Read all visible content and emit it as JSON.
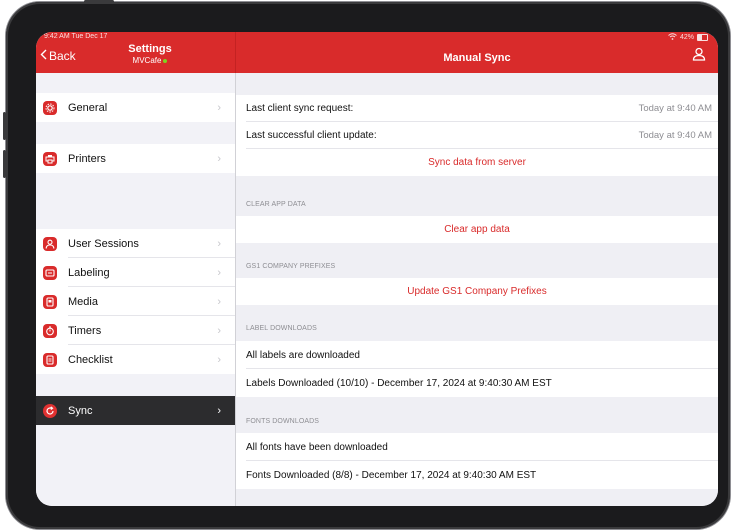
{
  "status": {
    "time": "9:42 AM  Tue Dec 17",
    "battery": "42%"
  },
  "nav": {
    "back_label": "Back",
    "settings_title": "Settings",
    "venue": "MVCafe",
    "page_title": "Manual Sync"
  },
  "sidebar": {
    "general": "General",
    "printers": "Printers",
    "user_sessions": "User Sessions",
    "labeling": "Labeling",
    "media": "Media",
    "timers": "Timers",
    "checklist": "Checklist",
    "sync": "Sync"
  },
  "sync": {
    "last_request_label": "Last client sync request:",
    "last_request_value": "Today at 9:40 AM",
    "last_update_label": "Last successful client update:",
    "last_update_value": "Today at 9:40 AM",
    "sync_button": "Sync data from server"
  },
  "clear": {
    "header": "CLEAR APP DATA",
    "button": "Clear app data"
  },
  "gs1": {
    "header": "GS1 COMPANY PREFIXES",
    "button": "Update GS1 Company Prefixes"
  },
  "labels": {
    "header": "LABEL DOWNLOADS",
    "status": "All labels are downloaded",
    "detail": "Labels Downloaded (10/10) - December 17, 2024 at 9:40:30 AM EST"
  },
  "fonts": {
    "header": "FONTS DOWNLOADS",
    "status": "All fonts have been downloaded",
    "detail": "Fonts Downloaded (8/8) - December 17, 2024 at 9:40:30 AM EST"
  },
  "colors": {
    "accent": "#d92b2b",
    "selected_row": "#2c2c2e",
    "online_dot": "#7ed321"
  }
}
